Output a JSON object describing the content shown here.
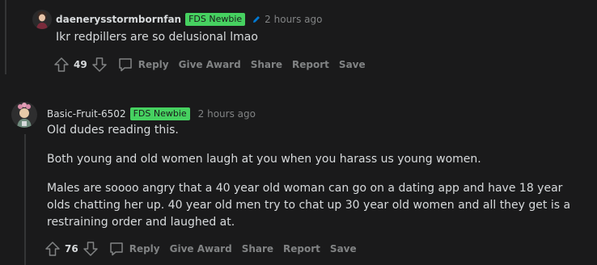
{
  "comments": [
    {
      "username": "daenerysstormbornfan",
      "flair": "FDS Newbie",
      "timestamp": "2 hours ago",
      "body": [
        "Ikr redpillers are so delusional lmao"
      ],
      "votes": "49",
      "actions": {
        "reply": "Reply",
        "award": "Give Award",
        "share": "Share",
        "report": "Report",
        "save": "Save"
      }
    },
    {
      "username": "Basic-Fruit-6502",
      "flair": "FDS Newbie",
      "timestamp": "2 hours ago",
      "body": [
        "Old dudes reading this.",
        "Both young and old women laugh at you when you harass us young women.",
        "Males are soooo angry that a 40 year old woman can go on a dating app and have 18 year olds chatting her up. 40 year old men try to chat up 30 year old women and all they get is a restraining order and laughed at."
      ],
      "votes": "76",
      "actions": {
        "reply": "Reply",
        "award": "Give Award",
        "share": "Share",
        "report": "Report",
        "save": "Save"
      }
    }
  ],
  "colors": {
    "background": "#1a1a1b",
    "flair": "#46d160",
    "muted": "#818384",
    "text": "#d7dadc",
    "edit_icon": "#0079d3"
  },
  "icons": [
    "upvote-icon",
    "downvote-icon",
    "comment-bubble-icon",
    "pencil-icon",
    "avatar"
  ]
}
